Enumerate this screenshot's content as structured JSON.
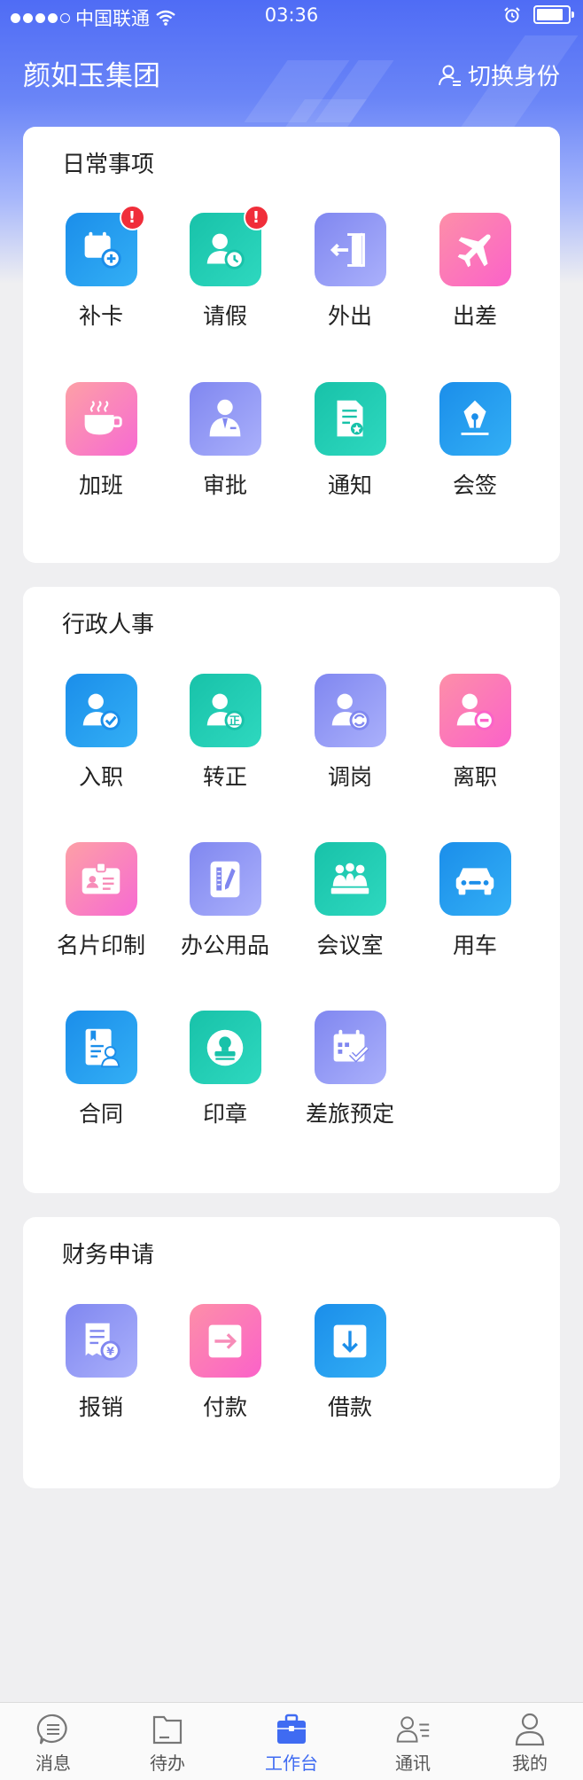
{
  "status_bar": {
    "carrier": "中国联通",
    "time": "03:36"
  },
  "header": {
    "company": "颜如玉集团",
    "switch_label": "切换身份"
  },
  "sections": {
    "daily": {
      "title": "日常事项",
      "items": [
        {
          "label": "补卡",
          "badge": "!",
          "icon": "calendar-add-icon"
        },
        {
          "label": "请假",
          "badge": "!",
          "icon": "user-clock-icon"
        },
        {
          "label": "外出",
          "icon": "door-exit-icon"
        },
        {
          "label": "出差",
          "icon": "airplane-icon"
        },
        {
          "label": "加班",
          "icon": "coffee-cup-icon"
        },
        {
          "label": "审批",
          "icon": "manager-icon"
        },
        {
          "label": "通知",
          "icon": "notice-doc-icon"
        },
        {
          "label": "会签",
          "icon": "pen-nib-icon"
        }
      ]
    },
    "hr": {
      "title": "行政人事",
      "items": [
        {
          "label": "入职",
          "icon": "user-check-icon"
        },
        {
          "label": "转正",
          "icon": "user-regular-icon",
          "glyph": "正"
        },
        {
          "label": "调岗",
          "icon": "user-transfer-icon"
        },
        {
          "label": "离职",
          "icon": "user-remove-icon"
        },
        {
          "label": "名片印制",
          "icon": "business-card-icon"
        },
        {
          "label": "办公用品",
          "icon": "stationery-icon"
        },
        {
          "label": "会议室",
          "icon": "meeting-room-icon"
        },
        {
          "label": "用车",
          "icon": "car-icon"
        },
        {
          "label": "合同",
          "icon": "contract-icon"
        },
        {
          "label": "印章",
          "icon": "seal-stamp-icon"
        },
        {
          "label": "差旅预定",
          "icon": "travel-booking-icon"
        }
      ]
    },
    "finance": {
      "title": "财务申请",
      "items": [
        {
          "label": "报销",
          "icon": "reimburse-icon",
          "glyph": "¥"
        },
        {
          "label": "付款",
          "icon": "payment-arrow-icon"
        },
        {
          "label": "借款",
          "icon": "loan-download-icon"
        }
      ]
    }
  },
  "tabs": [
    {
      "label": "消息",
      "icon": "chat-bubble-icon"
    },
    {
      "label": "待办",
      "icon": "folder-icon"
    },
    {
      "label": "工作台",
      "icon": "briefcase-icon",
      "active": true
    },
    {
      "label": "通讯",
      "icon": "contacts-icon"
    },
    {
      "label": "我的",
      "icon": "profile-icon"
    }
  ],
  "colors": {
    "accent": "#3f6bf2",
    "badge": "#f02e3a"
  }
}
